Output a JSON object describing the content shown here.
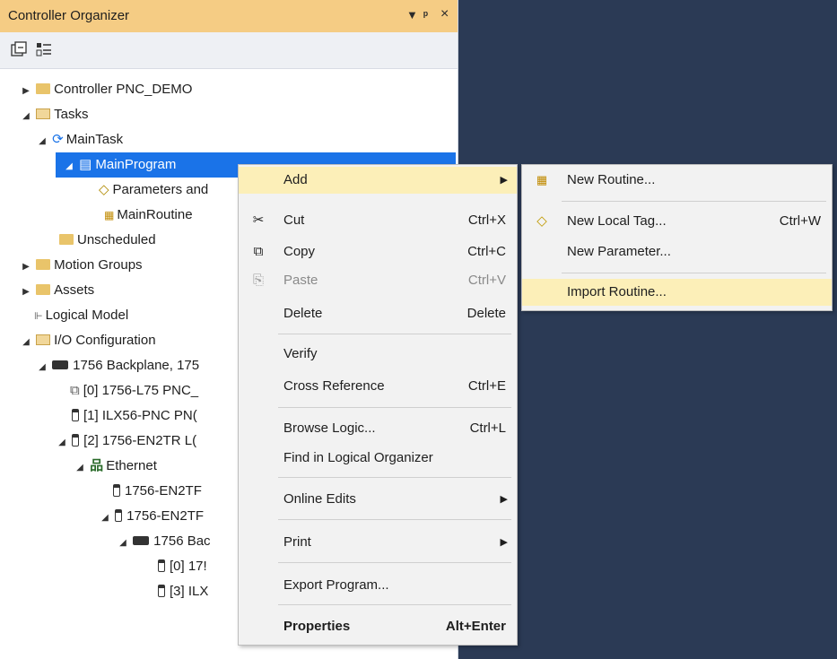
{
  "panel": {
    "title": "Controller Organizer",
    "pin_glyph": "▾",
    "dock_glyph": "ꟸ",
    "close_glyph": "×"
  },
  "tree": [
    {
      "label": "Controller PNC_DEMO"
    },
    {
      "label": "Tasks"
    },
    {
      "label": "MainTask"
    },
    {
      "label": "MainProgram"
    },
    {
      "label": "Parameters and"
    },
    {
      "label": "MainRoutine"
    },
    {
      "label": "Unscheduled"
    },
    {
      "label": "Motion Groups"
    },
    {
      "label": "Assets"
    },
    {
      "label": "Logical Model"
    },
    {
      "label": "I/O Configuration"
    },
    {
      "label": "1756 Backplane, 175"
    },
    {
      "label": "[0] 1756-L75 PNC_"
    },
    {
      "label": "[1] ILX56-PNC PN("
    },
    {
      "label": "[2] 1756-EN2TR L("
    },
    {
      "label": "Ethernet"
    },
    {
      "label": "1756-EN2TF"
    },
    {
      "label": "1756-EN2TF"
    },
    {
      "label": "1756 Bac"
    },
    {
      "label": "[0] 17!"
    },
    {
      "label": "[3] ILX"
    }
  ],
  "context_menu": {
    "items": [
      {
        "label": "Add",
        "shortcut": ""
      },
      {
        "label": "Cut",
        "shortcut": "Ctrl+X"
      },
      {
        "label": "Copy",
        "shortcut": "Ctrl+C"
      },
      {
        "label": "Paste",
        "shortcut": "Ctrl+V"
      },
      {
        "label": "Delete",
        "shortcut": "Delete"
      },
      {
        "label": "Verify",
        "shortcut": ""
      },
      {
        "label": "Cross Reference",
        "shortcut": "Ctrl+E"
      },
      {
        "label": "Browse Logic...",
        "shortcut": "Ctrl+L"
      },
      {
        "label": "Find in Logical Organizer",
        "shortcut": ""
      },
      {
        "label": "Online Edits",
        "shortcut": ""
      },
      {
        "label": "Print",
        "shortcut": ""
      },
      {
        "label": "Export Program...",
        "shortcut": ""
      },
      {
        "label": "Properties",
        "shortcut": "Alt+Enter"
      }
    ]
  },
  "submenu": {
    "items": [
      {
        "label": "New Routine...",
        "shortcut": ""
      },
      {
        "label": "New Local Tag...",
        "shortcut": "Ctrl+W"
      },
      {
        "label": "New Parameter...",
        "shortcut": ""
      },
      {
        "label": "Import Routine...",
        "shortcut": ""
      }
    ]
  },
  "colors": {
    "title_bg": "#f5cc84",
    "selection": "#1a73e8",
    "menu_highlight": "#fcefb8",
    "background": "#2b3a55"
  }
}
